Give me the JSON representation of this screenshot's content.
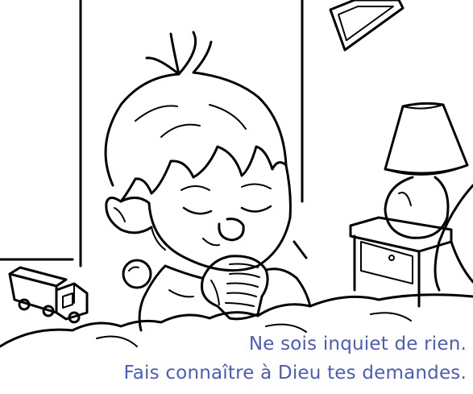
{
  "caption": {
    "line1": "Ne sois inquiet de rien.",
    "line2": "Fais connaître à Dieu tes demandes."
  },
  "colors": {
    "caption_text": "#4a5bc4",
    "line_art": "#000000",
    "background": "#ffffff"
  },
  "illustration": {
    "subject": "boy praying with folded hands",
    "icons": [
      "toy-truck-icon",
      "ball-icon",
      "lamp-icon",
      "nightstand-icon",
      "picture-frame-icon"
    ]
  }
}
